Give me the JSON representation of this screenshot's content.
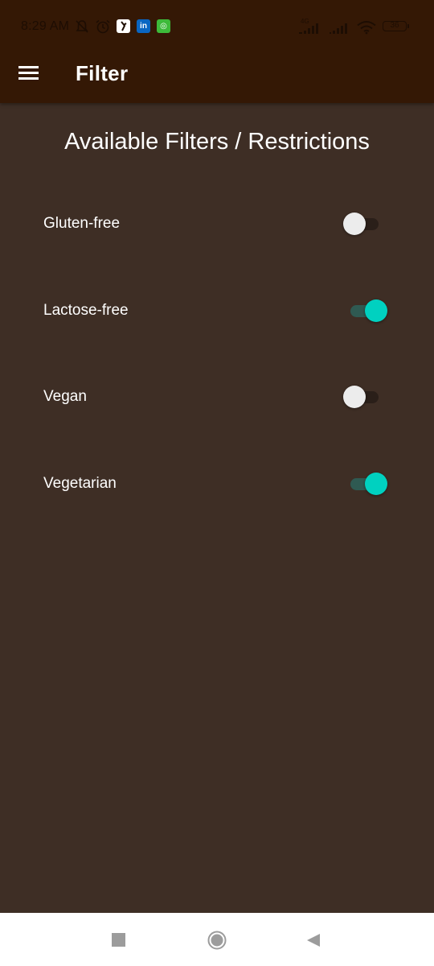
{
  "status_bar": {
    "time": "8:29 AM",
    "network_label": "4G",
    "battery": "36",
    "icons": [
      "mute-icon",
      "alarm-icon",
      "app-notification-icon",
      "linkedin-icon",
      "wechat-icon",
      "signal-icon",
      "signal-icon-2",
      "wifi-icon",
      "battery-icon"
    ],
    "app_badges": {
      "linkedin": "in",
      "other": "◎"
    }
  },
  "appbar": {
    "menu_icon": "hamburger-menu-icon",
    "title": "Filter"
  },
  "main": {
    "section_title": "Available Filters / Restrictions",
    "filters": [
      {
        "label": "Gluten-free",
        "enabled": false
      },
      {
        "label": "Lactose-free",
        "enabled": true
      },
      {
        "label": "Vegan",
        "enabled": false
      },
      {
        "label": "Vegetarian",
        "enabled": true
      }
    ]
  },
  "nav_bar": {
    "icons": [
      "recent-apps-icon",
      "home-icon",
      "back-icon"
    ]
  },
  "colors": {
    "appbar": "#341805",
    "background": "#3e2e25",
    "switch_on_thumb": "#00d1c0",
    "switch_on_track": "#2f5a52",
    "switch_off_thumb": "#ececec",
    "switch_off_track": "#2a1f19"
  }
}
